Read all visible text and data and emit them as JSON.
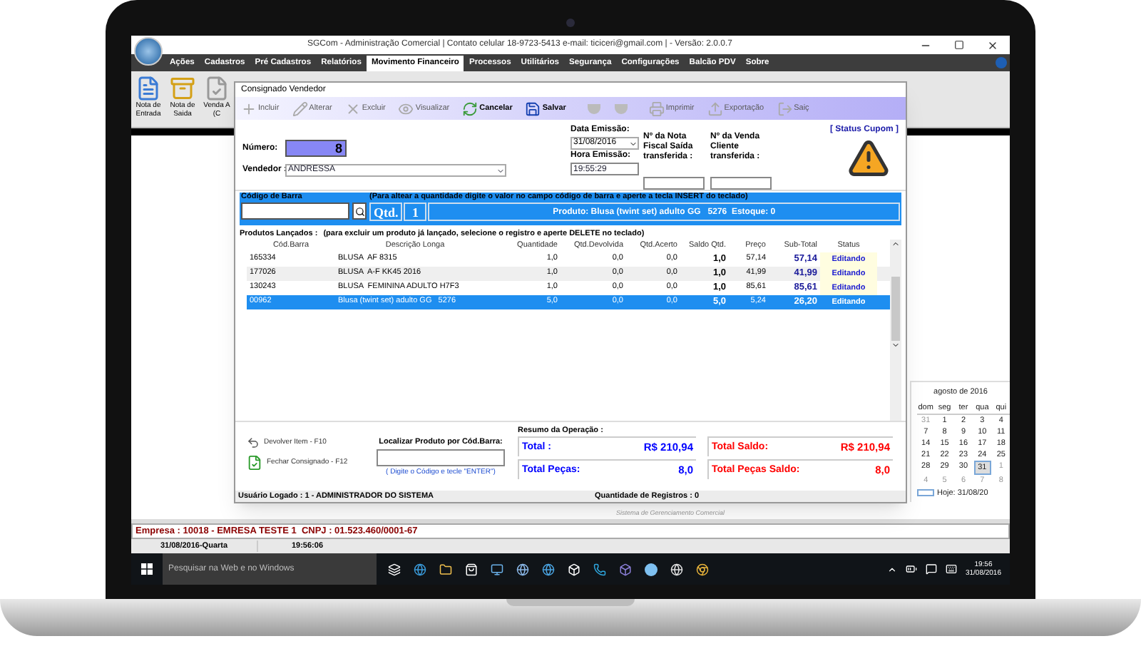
{
  "window": {
    "title": "SGCom - Administração Comercial | Contato celular 18-9723-5413 e-mail: ticiceri@gmail.com | - Versão: 2.0.0.7"
  },
  "menu": [
    {
      "label": "Ações",
      "selected": false
    },
    {
      "label": "Cadastros",
      "selected": false
    },
    {
      "label": "Pré Cadastros",
      "selected": false
    },
    {
      "label": "Relatórios",
      "selected": false
    },
    {
      "label": "Movimento Financeiro",
      "selected": true
    },
    {
      "label": "Processos",
      "selected": false
    },
    {
      "label": "Utilitários",
      "selected": false
    },
    {
      "label": "Segurança",
      "selected": false
    },
    {
      "label": "Configurações",
      "selected": false
    },
    {
      "label": "Balcão PDV",
      "selected": false
    },
    {
      "label": "Sobre",
      "selected": false
    }
  ],
  "ribbon": [
    {
      "label": "Nota de Entrada",
      "kind": "entrada"
    },
    {
      "label": "Nota de Saida",
      "kind": "saida"
    },
    {
      "label": "Venda A (C",
      "kind": "venda"
    }
  ],
  "dialog": {
    "title": "Consignado Vendedor",
    "toolbar": [
      {
        "label": "Incluir",
        "kind": "include",
        "disabled": true
      },
      {
        "label": "Alterar",
        "kind": "edit",
        "disabled": true
      },
      {
        "label": "Excluir",
        "kind": "delete",
        "disabled": true
      },
      {
        "label": "Visualizar",
        "kind": "view",
        "disabled": true
      },
      {
        "label": "Cancelar",
        "kind": "cancel",
        "disabled": false
      },
      {
        "label": "Salvar",
        "kind": "save",
        "disabled": false
      },
      {
        "label": "Imprimir",
        "kind": "print",
        "disabled": true
      },
      {
        "label": "Exportação",
        "kind": "export",
        "disabled": true
      },
      {
        "label": "Saiç",
        "kind": "exit",
        "disabled": true
      }
    ],
    "numero": {
      "label": "Número:",
      "value": "8"
    },
    "vendedor": {
      "label": "Vendedor :",
      "value": "ANDRESSA"
    },
    "data_emissao": {
      "label": "Data Emissão:",
      "value": "31/08/2016"
    },
    "hora_emissao": {
      "label": "Hora Emissão:",
      "value": "19:55:29"
    },
    "nota_fiscal": {
      "label": "Nº da Nota Fiscal Saída transferida :"
    },
    "venda_cliente": {
      "label": "Nº da Venda Cliente transferida :"
    },
    "status_cupom": "[ Status Cupom ]",
    "barcode": {
      "label": "Código de Barra",
      "hint": "(Para altear a quantidade digite o valor no campo código de barra e aperte a tecla INSERT do teclado)",
      "qty_label": "Qtd.",
      "qty": "1",
      "product": "Produto: Blusa (twint set) adulto GG   5276  Estoque: 0"
    },
    "products": {
      "title": "Produtos Lançados :",
      "note": "(para excluir um produto já lançado, selecione o registro e aperte DELETE no teclado)",
      "columns": [
        "Cód.Barra",
        "Descrição Longa",
        "Quantidade",
        "Qtd.Devolvida",
        "Qtd.Acerto",
        "Saldo Qtd.",
        "Preço",
        "Sub-Total",
        "Status"
      ],
      "rows": [
        {
          "cells": [
            "165334",
            "BLUSA  AF 8315",
            "1,0",
            "0,0",
            "0,0",
            "1,0",
            "57,14",
            "57,14",
            "Editando"
          ],
          "selected": false
        },
        {
          "cells": [
            "177026",
            "BLUSA  A-F KK45 2016",
            "1,0",
            "0,0",
            "0,0",
            "1,0",
            "41,99",
            "41,99",
            "Editando"
          ],
          "selected": false
        },
        {
          "cells": [
            "130243",
            "BLUSA  FEMININA ADULTO H7F3",
            "1,0",
            "0,0",
            "0,0",
            "1,0",
            "85,61",
            "85,61",
            "Editando"
          ],
          "selected": false
        },
        {
          "cells": [
            "00962",
            "Blusa (twint set) adulto GG   5276",
            "5,0",
            "0,0",
            "0,0",
            "5,0",
            "5,24",
            "26,20",
            "Editando"
          ],
          "selected": true
        }
      ]
    },
    "actions": [
      {
        "label": "Devolver Item - F10",
        "kind": "return"
      },
      {
        "label": "Fechar Consignado - F12",
        "kind": "close"
      }
    ],
    "search": {
      "label": "Localizar Produto por Cód.Barra:",
      "hint": "( Digite o Código e tecle \"ENTER\")"
    },
    "summary": {
      "title": "Resumo da Operação :",
      "items": [
        {
          "label": "Total :",
          "value": "R$ 210,94",
          "color": "#0000ff"
        },
        {
          "label": "Total Peças:",
          "value": "8,0",
          "color": "#0000ff"
        },
        {
          "label": "Total Saldo:",
          "value": "R$ 210,94",
          "color": "#ff0000"
        },
        {
          "label": "Total Peças Saldo:",
          "value": "8,0",
          "color": "#ff0000"
        }
      ]
    },
    "status": [
      "Usuário Logado : 1 - ADMINISTRADOR DO SISTEMA",
      "Quantidade de Registros : 0"
    ]
  },
  "logo": {
    "subtitle": "Sistema de Gerenciamento Comercial"
  },
  "calendar": {
    "month": "agosto de 2016",
    "weekdays": [
      "dom",
      "seg",
      "ter",
      "qua",
      "qui"
    ],
    "weeks": [
      [
        {
          "day": "31",
          "outside": true,
          "selected": false
        },
        {
          "day": "1",
          "outside": false,
          "selected": false
        },
        {
          "day": "2",
          "outside": false,
          "selected": false
        },
        {
          "day": "3",
          "outside": false,
          "selected": false
        },
        {
          "day": "4",
          "outside": false,
          "selected": false
        }
      ],
      [
        {
          "day": "7",
          "outside": false,
          "selected": false
        },
        {
          "day": "8",
          "outside": false,
          "selected": false
        },
        {
          "day": "9",
          "outside": false,
          "selected": false
        },
        {
          "day": "10",
          "outside": false,
          "selected": false
        },
        {
          "day": "11",
          "outside": false,
          "selected": false
        }
      ],
      [
        {
          "day": "14",
          "outside": false,
          "selected": false
        },
        {
          "day": "15",
          "outside": false,
          "selected": false
        },
        {
          "day": "16",
          "outside": false,
          "selected": false
        },
        {
          "day": "17",
          "outside": false,
          "selected": false
        },
        {
          "day": "18",
          "outside": false,
          "selected": false
        }
      ],
      [
        {
          "day": "21",
          "outside": false,
          "selected": false
        },
        {
          "day": "22",
          "outside": false,
          "selected": false
        },
        {
          "day": "23",
          "outside": false,
          "selected": false
        },
        {
          "day": "24",
          "outside": false,
          "selected": false
        },
        {
          "day": "25",
          "outside": false,
          "selected": false
        }
      ],
      [
        {
          "day": "28",
          "outside": false,
          "selected": false
        },
        {
          "day": "29",
          "outside": false,
          "selected": false
        },
        {
          "day": "30",
          "outside": false,
          "selected": false
        },
        {
          "day": "31",
          "outside": false,
          "selected": true
        },
        {
          "day": "1",
          "outside": true,
          "selected": false
        }
      ],
      [
        {
          "day": "4",
          "outside": true,
          "selected": false
        },
        {
          "day": "5",
          "outside": true,
          "selected": false
        },
        {
          "day": "6",
          "outside": true,
          "selected": false
        },
        {
          "day": "7",
          "outside": true,
          "selected": false
        },
        {
          "day": "8",
          "outside": true,
          "selected": false
        }
      ]
    ],
    "today": "Hoje: 31/08/20"
  },
  "company": "Empresa : 10018 - EMRESA TESTE 1  CNPJ : 01.523.460/0001-67",
  "datebar": [
    "31/08/2016-Quarta",
    "19:56:06"
  ],
  "taskbar": {
    "search_placeholder": "Pesquisar na Web e no Windows",
    "time": "19:56",
    "date": "31/08/2016"
  }
}
